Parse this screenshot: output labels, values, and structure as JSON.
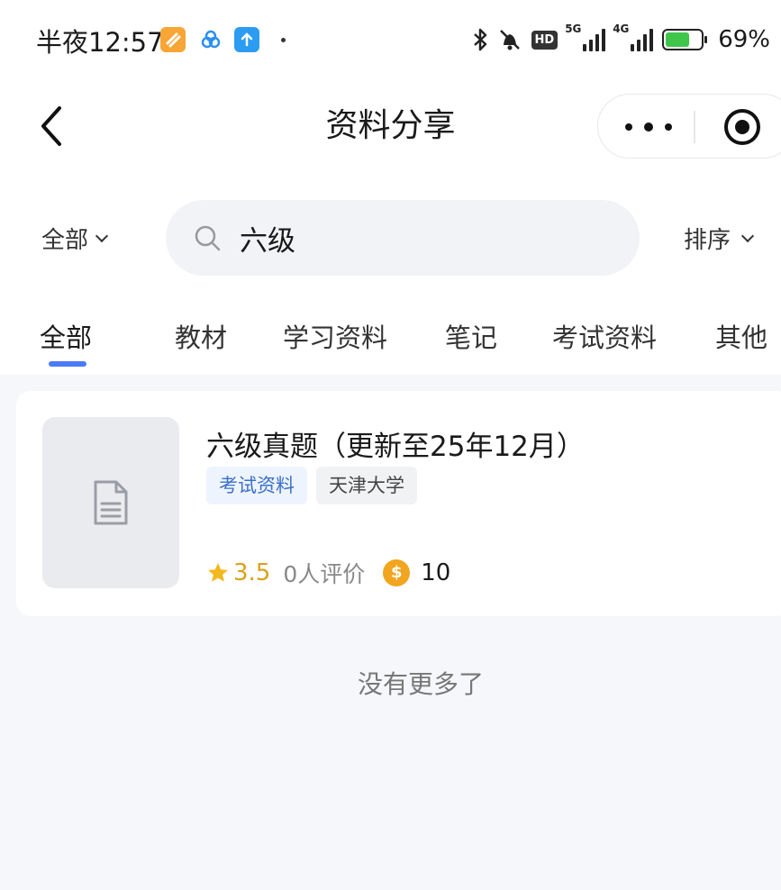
{
  "status_bar": {
    "time": "半夜12:57",
    "network_badge": "HD",
    "sim1": "5G",
    "sim2": "4G",
    "battery_percent": "69%",
    "battery_level": 0.69
  },
  "nav": {
    "title": "资料分享",
    "back_icon": "chevron-left-icon",
    "more_icon": "more-dots-icon",
    "close_icon": "target-close-icon"
  },
  "search_bar": {
    "filter_label": "全部",
    "query": "六级",
    "sort_label": "排序"
  },
  "tabs": [
    {
      "label": "全部",
      "active": true
    },
    {
      "label": "教材",
      "active": false
    },
    {
      "label": "学习资料",
      "active": false
    },
    {
      "label": "笔记",
      "active": false
    },
    {
      "label": "考试资料",
      "active": false
    },
    {
      "label": "其他",
      "active": false
    }
  ],
  "results": [
    {
      "title": "六级真题（更新至25年12月）",
      "tags": [
        "考试资料",
        "天津大学"
      ],
      "rating": "3.5",
      "review_count": "0人评价",
      "price": "10",
      "thumbnail_icon": "document-icon"
    }
  ],
  "footer": {
    "no_more_text": "没有更多了"
  },
  "colors": {
    "accent": "#4a7bf7",
    "rating": "#d9a21b",
    "coin": "#f2a51f",
    "tag_type_text": "#3b6fc9",
    "battery": "#3fc64a"
  }
}
